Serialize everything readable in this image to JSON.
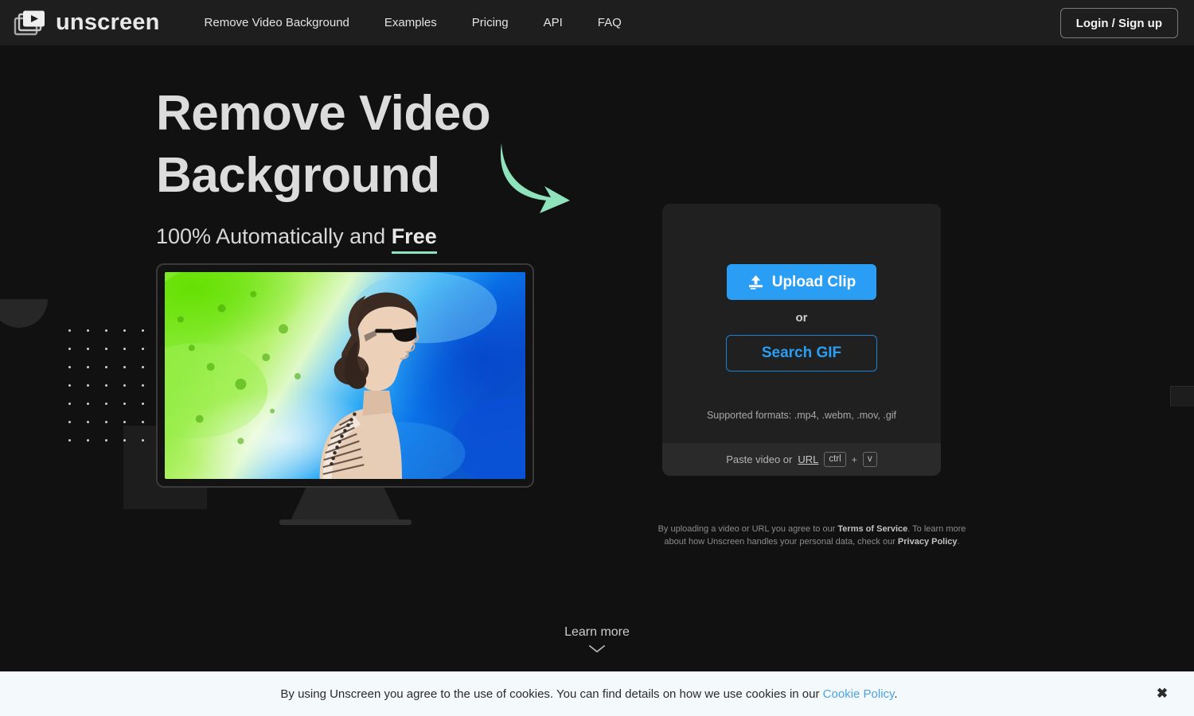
{
  "header": {
    "logo_text": "unscreen",
    "logo_icon": "video-frames-play-icon",
    "nav": [
      {
        "label": "Remove Video Background"
      },
      {
        "label": "Examples"
      },
      {
        "label": "Pricing"
      },
      {
        "label": "API"
      },
      {
        "label": "FAQ"
      }
    ],
    "login_label": "Login / Sign up"
  },
  "hero": {
    "title_line1": "Remove Video",
    "title_line2": "Background",
    "subtitle_prefix": "100% Automatically and ",
    "subtitle_highlight": "Free",
    "arrow_icon": "curved-arrow-down-right-icon",
    "arrow_color": "#8fe3bc"
  },
  "upload": {
    "upload_label": "Upload Clip",
    "upload_icon": "upload-icon",
    "or_label": "or",
    "search_gif_label": "Search GIF",
    "formats_label": "Supported formats: .mp4, .webm, .mov, .gif",
    "paste_prefix": "Paste video or ",
    "paste_url_link": "URL",
    "key_ctrl": "ctrl",
    "key_plus": "+",
    "key_v": "v"
  },
  "legal": {
    "line1_before": "By uploading a video or URL you agree to our ",
    "terms_link": "Terms of Service",
    "line1_after": ". To learn more",
    "line2_before": "about how Unscreen handles your personal data, check our ",
    "privacy_link": "Privacy Policy",
    "line2_after": "."
  },
  "learn_more": {
    "label": "Learn more",
    "icon": "chevron-down-icon"
  },
  "cookie": {
    "text_before": "By using Unscreen you agree to the use of cookies. You can find details on how we use cookies in our ",
    "link_label": "Cookie Policy",
    "text_after": ".",
    "close_icon": "close-icon",
    "close_glyph": "✖"
  },
  "colors": {
    "page_bg": "#111111",
    "header_bg": "#1e1e1e",
    "card_bg": "#202020",
    "paste_bar_bg": "#2a2a2a",
    "accent_blue": "#2a9df4",
    "accent_green": "#8fe3bc",
    "cookie_bg": "#f4f9fc",
    "cookie_link": "#4aa3e8"
  }
}
